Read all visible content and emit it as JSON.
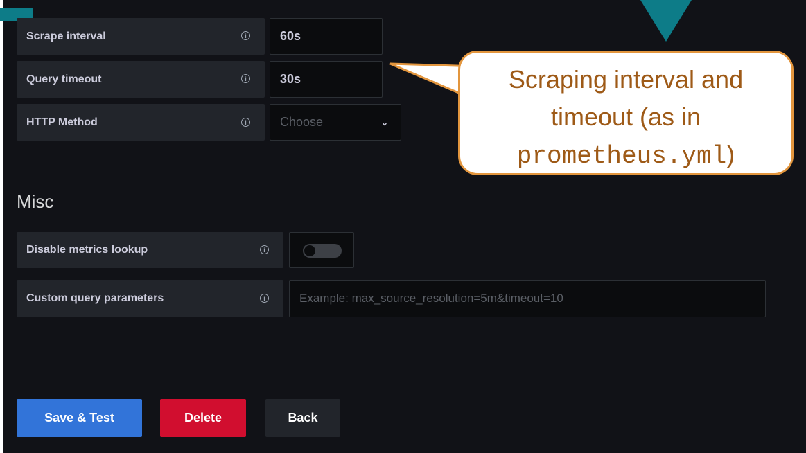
{
  "form": {
    "fields": [
      {
        "label": "Scrape interval",
        "value": "60s"
      },
      {
        "label": "Query timeout",
        "value": "30s"
      },
      {
        "label": "HTTP Method",
        "placeholder": "Choose"
      }
    ],
    "misc": {
      "title": "Misc",
      "disable_metrics_label": "Disable metrics lookup",
      "disable_metrics_enabled": false,
      "custom_params_label": "Custom query parameters",
      "custom_params_placeholder": "Example: max_source_resolution=5m&timeout=10"
    }
  },
  "buttons": {
    "save": "Save & Test",
    "delete": "Delete",
    "back": "Back"
  },
  "callout": {
    "line1": "Scraping interval and",
    "line2": "timeout (as in",
    "line3_code": "prometheus.yml",
    "line3_suffix": ")"
  },
  "colors": {
    "background": "#111217",
    "save_button": "#3274d9",
    "delete_button": "#d10e2f",
    "back_button": "#22252b",
    "callout_border": "#e3963e",
    "callout_text": "#9e5a17",
    "accent_teal": "#0d7c88"
  },
  "icons": [
    "info-icon",
    "chevron-down-icon"
  ]
}
